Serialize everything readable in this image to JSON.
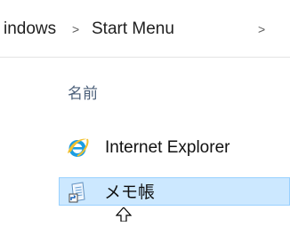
{
  "breadcrumb": {
    "items": [
      "indows",
      "Start Menu"
    ],
    "separator": ">"
  },
  "list": {
    "column_header": "名前",
    "items": [
      {
        "label": "Internet Explorer",
        "icon": "internet-explorer-icon",
        "selected": false
      },
      {
        "label": "メモ帳",
        "icon": "notepad-icon",
        "selected": true
      }
    ]
  },
  "colors": {
    "selection_fill": "#cce8ff",
    "selection_border": "#99d1ff",
    "header_text": "#4c607a"
  }
}
